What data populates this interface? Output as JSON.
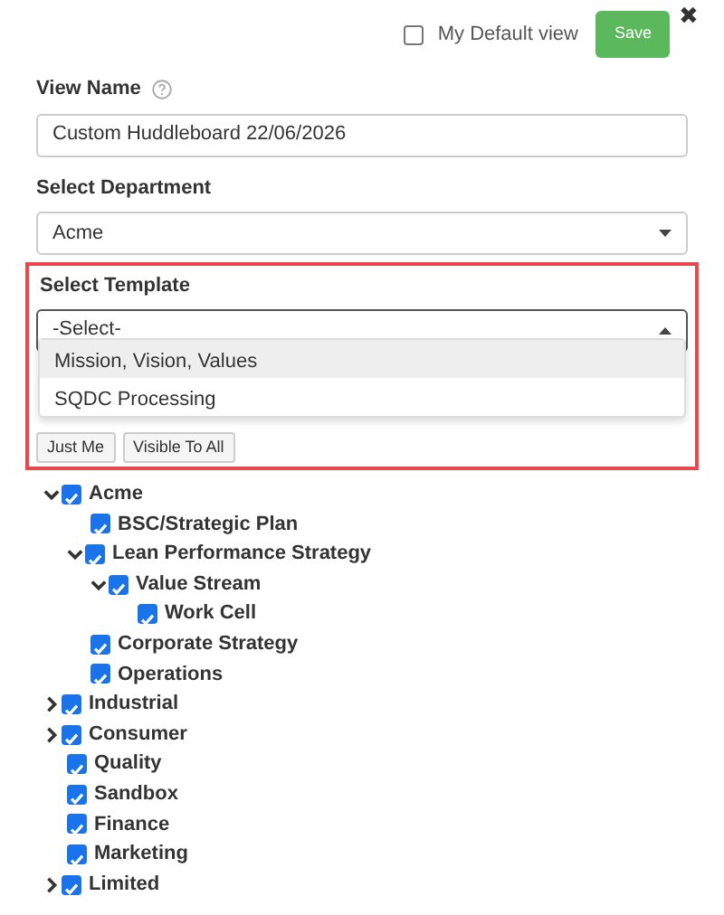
{
  "close": "✖",
  "default_view": {
    "label": "My Default view",
    "checked": false
  },
  "save_button": "Save",
  "view_name": {
    "label": "View Name",
    "value": "Custom Huddleboard 22/06/2026"
  },
  "department": {
    "label": "Select Department",
    "value": "Acme"
  },
  "template": {
    "label": "Select Template",
    "value": "-Select-",
    "expanded": true,
    "options": [
      {
        "label": "Mission, Vision, Values",
        "selected": true
      },
      {
        "label": "SQDC Processing",
        "selected": false
      }
    ]
  },
  "visibility_buttons": [
    "Just Me",
    "Visible To All"
  ],
  "tree": [
    {
      "label": "Acme",
      "checked": true,
      "kind": "group",
      "expanded": true,
      "children": [
        {
          "label": "BSC/Strategic Plan",
          "checked": true,
          "kind": "leaf"
        },
        {
          "label": "Lean Performance Strategy",
          "checked": true,
          "kind": "group",
          "expanded": true,
          "children": [
            {
              "label": "Value Stream",
              "checked": true,
              "kind": "group",
              "expanded": true,
              "children": [
                {
                  "label": "Work Cell",
                  "checked": true,
                  "kind": "leaf"
                }
              ]
            }
          ]
        },
        {
          "label": "Corporate Strategy",
          "checked": true,
          "kind": "leaf"
        },
        {
          "label": "Operations",
          "checked": true,
          "kind": "leaf"
        }
      ]
    },
    {
      "label": "Industrial",
      "checked": true,
      "kind": "group",
      "expanded": false
    },
    {
      "label": "Consumer",
      "checked": true,
      "kind": "group",
      "expanded": false
    },
    {
      "label": "Quality",
      "checked": true,
      "kind": "leaf"
    },
    {
      "label": "Sandbox",
      "checked": true,
      "kind": "leaf"
    },
    {
      "label": "Finance",
      "checked": true,
      "kind": "leaf"
    },
    {
      "label": "Marketing",
      "checked": true,
      "kind": "leaf"
    },
    {
      "label": "Limited",
      "checked": true,
      "kind": "group",
      "expanded": false
    }
  ]
}
